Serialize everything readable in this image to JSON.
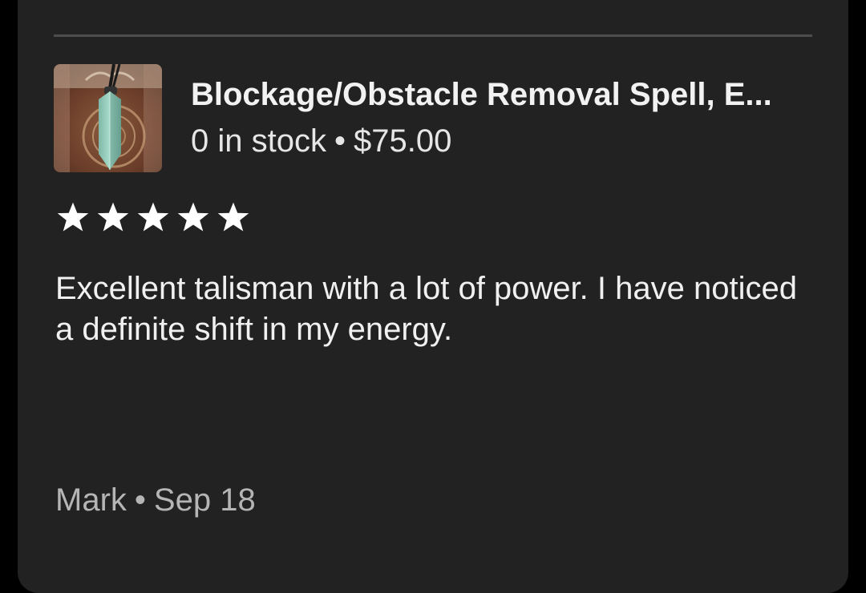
{
  "review": {
    "product": {
      "title": "Blockage/Obstacle Removal Spell, E...",
      "stock": "0 in stock",
      "separator": "•",
      "price": "$75.00",
      "thumbnail": "crystal-pendant-product-thumbnail"
    },
    "rating": 5,
    "rating_max": 5,
    "star_icon": "star-icon",
    "star_color": "#ffffff",
    "text": "Excellent talisman with a lot of power. I have noticed a definite shift in my energy.",
    "author": "Mark",
    "author_separator": "•",
    "date": "Sep 18"
  },
  "colors": {
    "background": "#000000",
    "card": "#222222",
    "divider": "#4d4d4d",
    "primary_text": "#f2f2f2",
    "secondary_text": "#b5b5b5"
  }
}
